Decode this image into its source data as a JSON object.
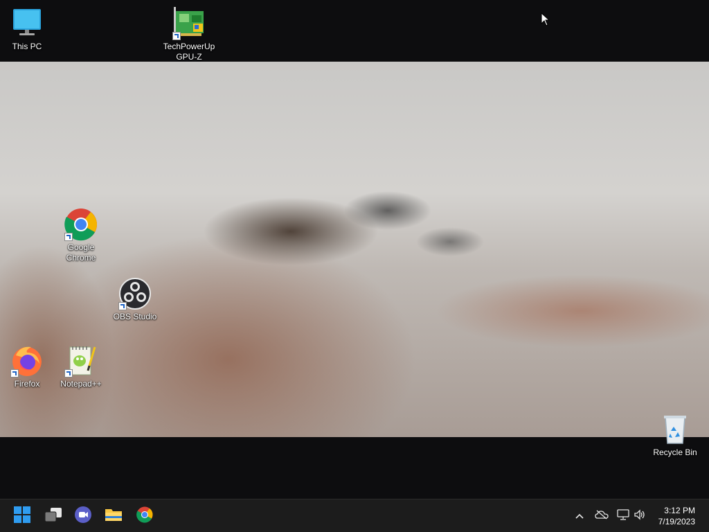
{
  "desktop": {
    "icons": [
      {
        "label": "This PC",
        "icon": "monitor-icon"
      },
      {
        "label": "TechPowerUp GPU-Z",
        "icon": "gpu-z-icon"
      },
      {
        "label": "Google Chrome",
        "icon": "chrome-icon"
      },
      {
        "label": "OBS Studio",
        "icon": "obs-icon"
      },
      {
        "label": "Firefox",
        "icon": "firefox-icon"
      },
      {
        "label": "Notepad++",
        "icon": "notepad-plus-plus-icon"
      },
      {
        "label": "Recycle Bin",
        "icon": "recycle-bin-icon"
      }
    ]
  },
  "taskbar": {
    "buttons": [
      {
        "name": "start",
        "icon": "windows-logo-icon"
      },
      {
        "name": "task-view",
        "icon": "task-view-icon"
      },
      {
        "name": "chat",
        "icon": "chat-icon"
      },
      {
        "name": "file-explorer",
        "icon": "folder-icon"
      },
      {
        "name": "chrome",
        "icon": "chrome-icon"
      }
    ],
    "tray": {
      "icons": [
        "chevron-up-icon",
        "onedrive-icon",
        "network-icon",
        "volume-icon"
      ],
      "time": "3:12 PM",
      "date": "7/19/2023"
    }
  },
  "colors": {
    "taskbar_bg": "#1c1c1c",
    "desktop_bg": "#0d0d0f",
    "accent_blue": "#1e63c4"
  }
}
